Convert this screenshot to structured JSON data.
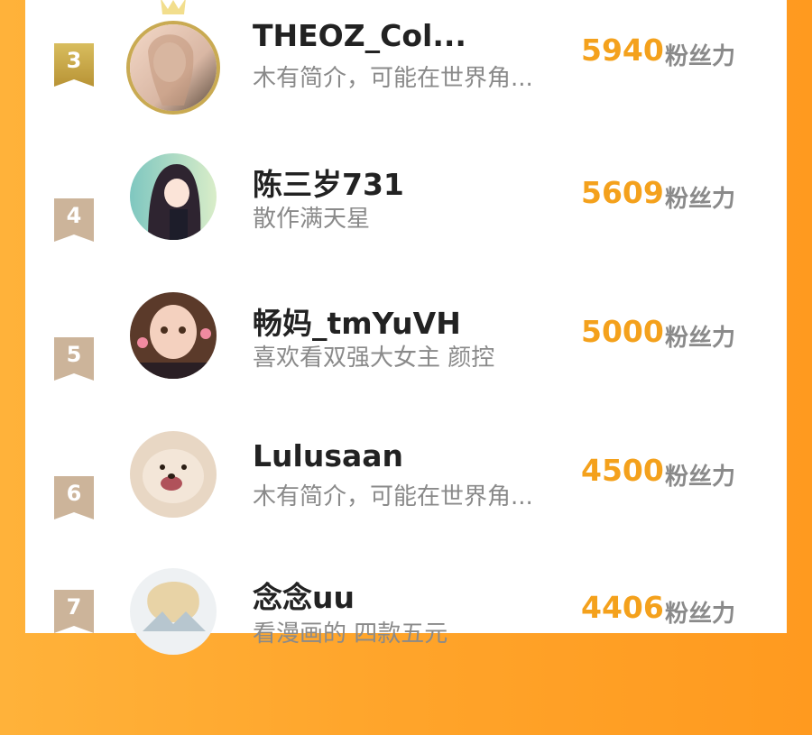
{
  "ranking": {
    "unit_label": "粉丝力",
    "items": [
      {
        "rank": "3",
        "name": "THEOZ_Col...",
        "bio": "木有简介，可能在世界角...",
        "score": "5940"
      },
      {
        "rank": "4",
        "name": "陈三岁731",
        "bio": "散作满天星",
        "score": "5609"
      },
      {
        "rank": "5",
        "name": "畅妈_tmYuVH",
        "bio": "喜欢看双强大女主 颜控",
        "score": "5000"
      },
      {
        "rank": "6",
        "name": "Lulusaan",
        "bio": "木有简介，可能在世界角...",
        "score": "4500"
      },
      {
        "rank": "7",
        "name": "念念uu",
        "bio": "看漫画的 四款五元",
        "score": "4406"
      }
    ]
  },
  "colors": {
    "background": "#ffa42a",
    "accent_score": "#f4a11c",
    "rank3_badge": "#c9a84a",
    "rank_badge": "#ccb49a"
  }
}
